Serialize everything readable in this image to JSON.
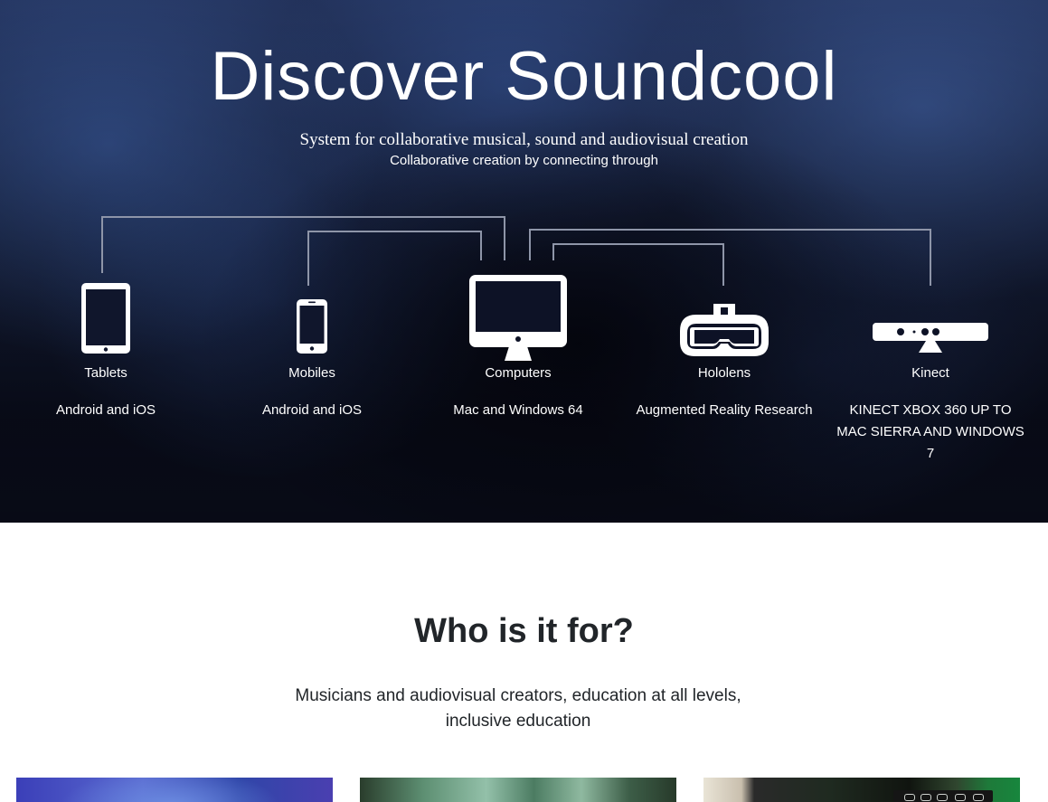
{
  "hero": {
    "title": "Discover Soundcool",
    "subtitle": "System for collaborative musical, sound and audiovisual creation",
    "tagline": "Collaborative creation by connecting through"
  },
  "devices": [
    {
      "name": "Tablets",
      "description": "Android and iOS",
      "icon": "tablet-icon"
    },
    {
      "name": "Mobiles",
      "description": "Android and iOS",
      "icon": "mobile-icon"
    },
    {
      "name": "Computers",
      "description": "Mac and Windows 64",
      "icon": "computer-icon"
    },
    {
      "name": "Hololens",
      "description": "Augmented Reality Research",
      "icon": "vr-headset-icon"
    },
    {
      "name": "Kinect",
      "description": "KINECT XBOX 360 UP TO MAC SIERRA AND WINDOWS 7",
      "icon": "kinect-icon"
    }
  ],
  "who": {
    "title": "Who is it for?",
    "text": "Musicians and audiovisual creators, education at all levels, inclusive education"
  },
  "colors": {
    "hero_text": "#ffffff",
    "connector_lines": "#8e95a8",
    "body_text": "#212529"
  }
}
